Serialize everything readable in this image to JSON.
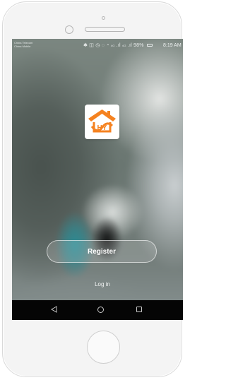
{
  "status_bar": {
    "carrier_1": "China Telecom",
    "carrier_2": "China Mobile",
    "network_1": "4G",
    "network_2": "4G",
    "battery": "98%",
    "time": "8:19 AM"
  },
  "app": {
    "logo_text": "HY",
    "register_label": "Register",
    "login_label": "Log in"
  },
  "colors": {
    "logo_orange": "#f58220",
    "navbar": "#050505"
  },
  "icons": {
    "back": "back-triangle-icon",
    "home": "home-circle-icon",
    "recent": "recent-apps-icon"
  }
}
